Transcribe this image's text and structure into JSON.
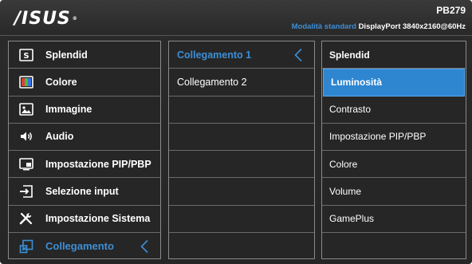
{
  "header": {
    "logo": "/ISUS",
    "logo_mark": "®",
    "model": "PB279",
    "mode": "Modalità standard",
    "input": "DisplayPort",
    "resolution": "3840x2160@60Hz"
  },
  "main_menu": {
    "items": [
      {
        "label": "Splendid",
        "icon": "splendid-icon"
      },
      {
        "label": "Colore",
        "icon": "color-icon"
      },
      {
        "label": "Immagine",
        "icon": "image-icon"
      },
      {
        "label": "Audio",
        "icon": "speaker-icon"
      },
      {
        "label": "Impostazione PIP/PBP",
        "icon": "pip-icon"
      },
      {
        "label": "Selezione input",
        "icon": "input-icon"
      },
      {
        "label": "Impostazione Sistema",
        "icon": "tools-icon"
      },
      {
        "label": "Collegamento",
        "icon": "shortcut-icon"
      }
    ],
    "active_index": 7
  },
  "sub_menu": {
    "items": [
      {
        "label": "Collegamento 1"
      },
      {
        "label": "Collegamento 2"
      },
      {
        "label": ""
      },
      {
        "label": ""
      },
      {
        "label": ""
      },
      {
        "label": ""
      },
      {
        "label": ""
      },
      {
        "label": ""
      }
    ],
    "active_index": 0
  },
  "options": {
    "items": [
      {
        "label": "Splendid"
      },
      {
        "label": "Luminosità"
      },
      {
        "label": "Contrasto"
      },
      {
        "label": "Impostazione PIP/PBP"
      },
      {
        "label": "Colore"
      },
      {
        "label": "Volume"
      },
      {
        "label": "GamePlus"
      },
      {
        "label": ""
      }
    ],
    "selected_index": 1
  },
  "colors": {
    "accent": "#3d8fd6",
    "selected_bg": "#2e86d1",
    "background": "#262626"
  }
}
